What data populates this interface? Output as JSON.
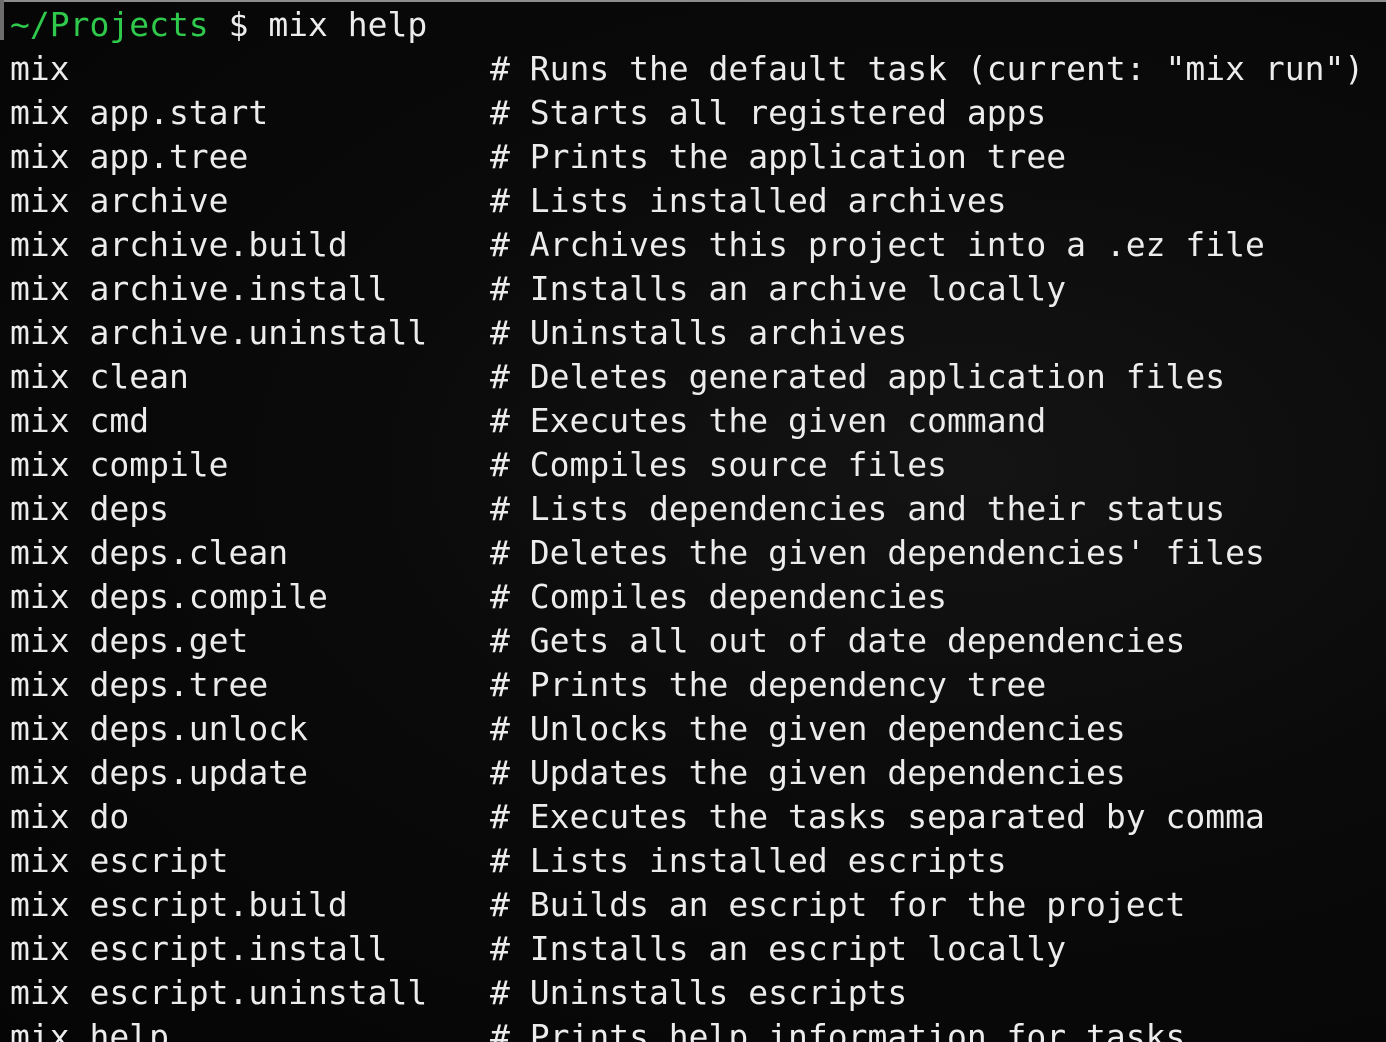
{
  "prompt": {
    "cwd": "~/Projects",
    "symbol": "$",
    "command": "mix help"
  },
  "colors": {
    "background": "#0a0a0a",
    "text": "#ececec",
    "cwd": "#2fc94b"
  },
  "tasks": [
    {
      "task": "mix",
      "desc": "# Runs the default task (current: \"mix run\")"
    },
    {
      "task": "mix app.start",
      "desc": "# Starts all registered apps"
    },
    {
      "task": "mix app.tree",
      "desc": "# Prints the application tree"
    },
    {
      "task": "mix archive",
      "desc": "# Lists installed archives"
    },
    {
      "task": "mix archive.build",
      "desc": "# Archives this project into a .ez file"
    },
    {
      "task": "mix archive.install",
      "desc": "# Installs an archive locally"
    },
    {
      "task": "mix archive.uninstall",
      "desc": "# Uninstalls archives"
    },
    {
      "task": "mix clean",
      "desc": "# Deletes generated application files"
    },
    {
      "task": "mix cmd",
      "desc": "# Executes the given command"
    },
    {
      "task": "mix compile",
      "desc": "# Compiles source files"
    },
    {
      "task": "mix deps",
      "desc": "# Lists dependencies and their status"
    },
    {
      "task": "mix deps.clean",
      "desc": "# Deletes the given dependencies' files"
    },
    {
      "task": "mix deps.compile",
      "desc": "# Compiles dependencies"
    },
    {
      "task": "mix deps.get",
      "desc": "# Gets all out of date dependencies"
    },
    {
      "task": "mix deps.tree",
      "desc": "# Prints the dependency tree"
    },
    {
      "task": "mix deps.unlock",
      "desc": "# Unlocks the given dependencies"
    },
    {
      "task": "mix deps.update",
      "desc": "# Updates the given dependencies"
    },
    {
      "task": "mix do",
      "desc": "# Executes the tasks separated by comma"
    },
    {
      "task": "mix escript",
      "desc": "# Lists installed escripts"
    },
    {
      "task": "mix escript.build",
      "desc": "# Builds an escript for the project"
    },
    {
      "task": "mix escript.install",
      "desc": "# Installs an escript locally"
    },
    {
      "task": "mix escript.uninstall",
      "desc": "# Uninstalls escripts"
    },
    {
      "task": "mix help",
      "desc": "# Prints help information for tasks"
    }
  ]
}
